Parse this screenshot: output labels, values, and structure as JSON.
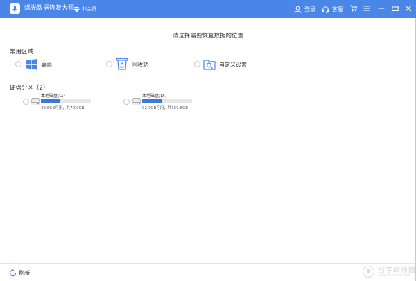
{
  "titlebar": {
    "app_title": "烁光数据恢复大师",
    "vip_label": "非会员",
    "login_label": "登录",
    "service_label": "客服"
  },
  "main": {
    "prompt": "请选择需要恢复数据的位置",
    "common_section_title": "常用区域",
    "locations": [
      {
        "label": "桌面",
        "icon": "windows-icon"
      },
      {
        "label": "回收站",
        "icon": "recycle-bin-icon"
      },
      {
        "label": "自定义设置",
        "icon": "folder-search-icon"
      }
    ],
    "disk_section_title": "硬盘分区（2）",
    "disks": [
      {
        "name": "本地磁盘(C:)",
        "info": "42.6GB可用，共70.0GB",
        "used_fraction": 0.39
      },
      {
        "name": "本地磁盘(D:)",
        "info": "92.7GB可用，共155.6GB",
        "used_fraction": 0.4
      }
    ]
  },
  "bottombar": {
    "refresh_label": "刷新"
  },
  "watermark": {
    "text": "当下软件园",
    "sub": "www.downxia.com"
  },
  "colors": {
    "accent": "#4a86e8",
    "bar_fill": "#3a78e0",
    "bar_track": "#e6e6e6"
  }
}
